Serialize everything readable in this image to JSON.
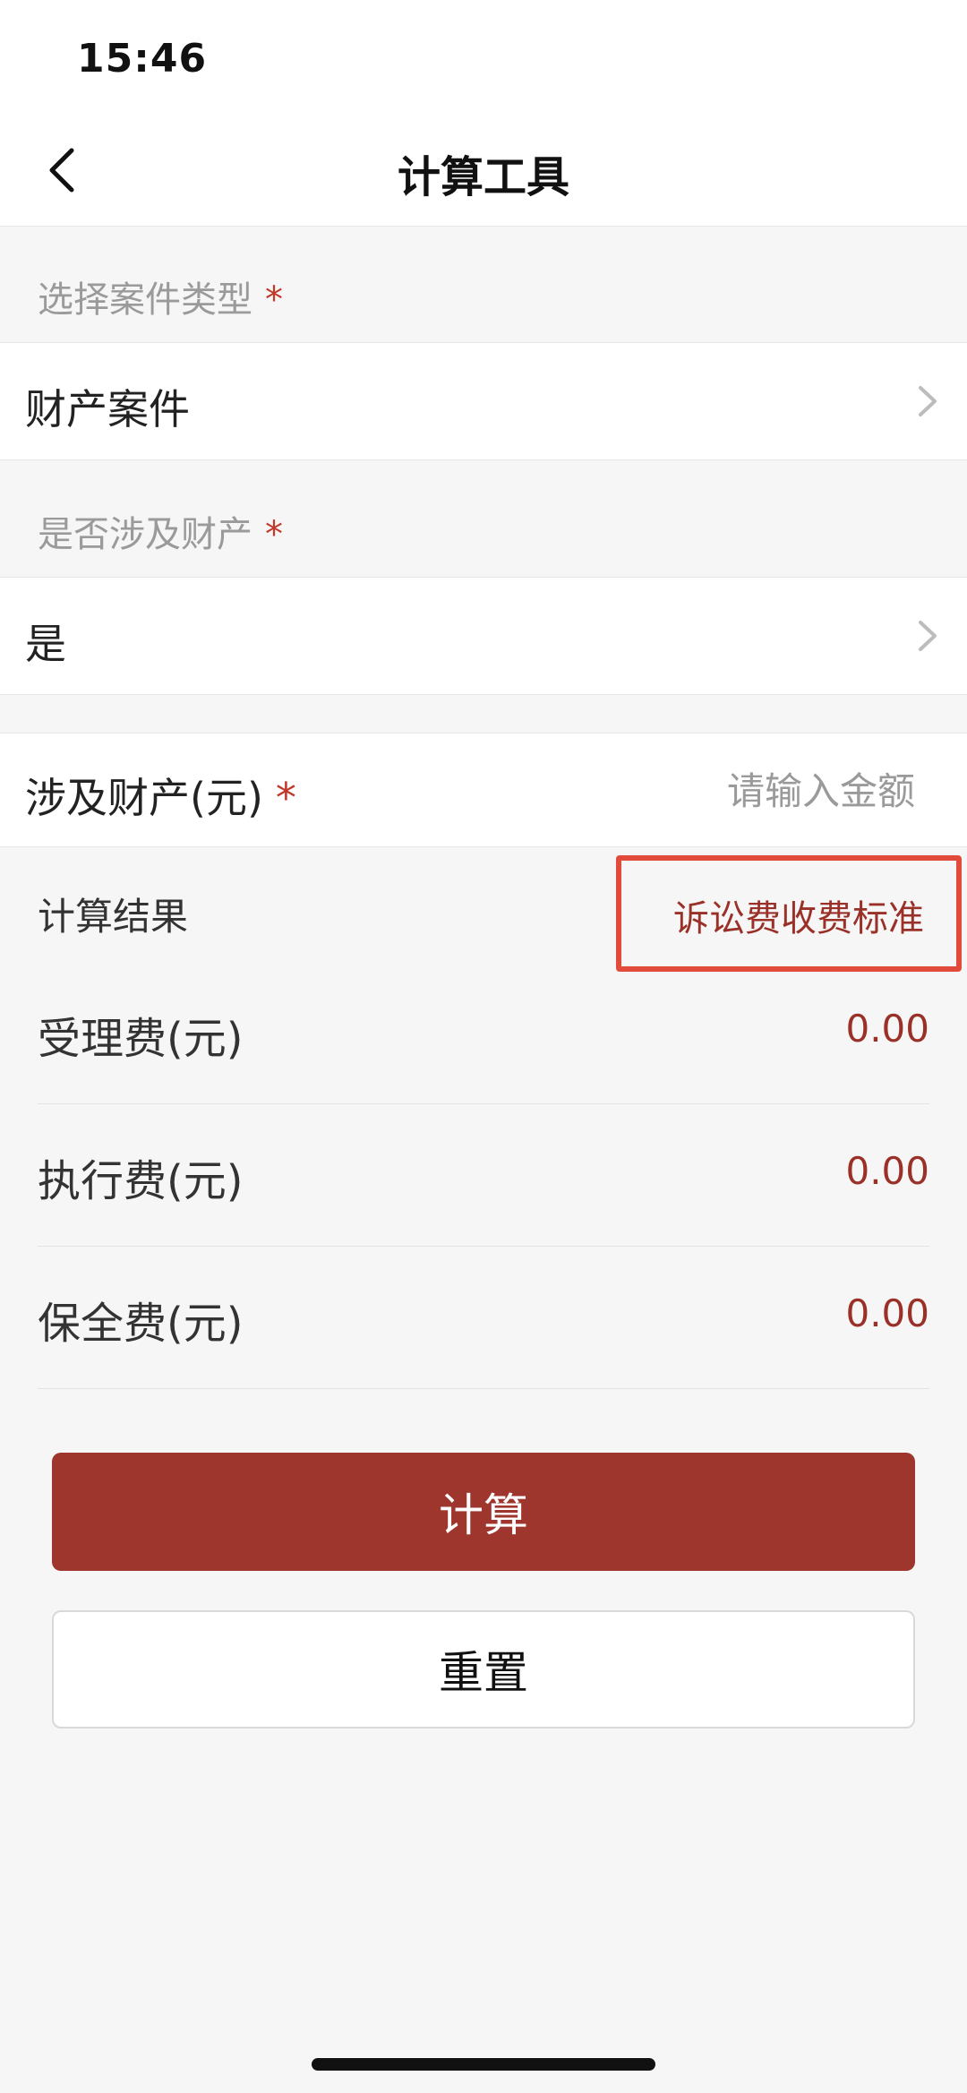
{
  "status_bar": {
    "time": "15:46"
  },
  "nav": {
    "title": "计算工具",
    "back_icon": "chevron-left-icon"
  },
  "case_type": {
    "label": "选择案件类型",
    "required_mark": "*",
    "value": "财产案件",
    "chevron_icon": "chevron-right-icon"
  },
  "involves_property": {
    "label": "是否涉及财产",
    "required_mark": "*",
    "value": "是",
    "chevron_icon": "chevron-right-icon"
  },
  "property_amount": {
    "label": "涉及财产(元)",
    "required_mark": "*",
    "value": "",
    "placeholder": "请输入金额"
  },
  "result": {
    "header": "计算结果",
    "fee_standard_link": "诉讼费收费标准",
    "rows": [
      {
        "label": "受理费(元)",
        "value": "0.00"
      },
      {
        "label": "执行费(元)",
        "value": "0.00"
      },
      {
        "label": "保全费(元)",
        "value": "0.00"
      }
    ]
  },
  "buttons": {
    "calculate": "计算",
    "reset": "重置"
  },
  "colors": {
    "accent": "#9e362e",
    "required": "#c0392b",
    "highlight_box": "#e24a3b",
    "placeholder": "#9a9a9a"
  }
}
